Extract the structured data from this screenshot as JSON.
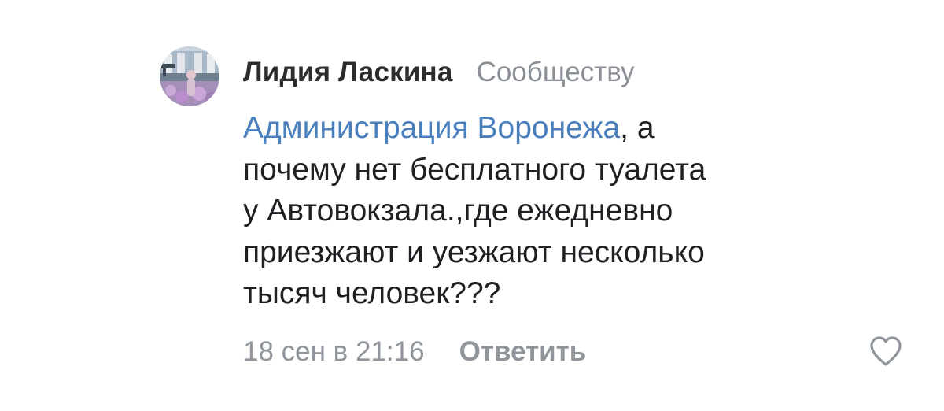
{
  "comment": {
    "author": {
      "name": "Лидия Ласкина",
      "avatar_icon": "avatar-photo"
    },
    "recipient_label": "Сообществу",
    "text": {
      "mention": "Администрация Воронежа",
      "lines": [
        ", а",
        "почему нет бесплатного туалета",
        "у Автовокзала.,где ежедневно",
        "приезжают и уезжают несколько",
        "тысяч человек???"
      ]
    },
    "timestamp": "18 сен в 21:16",
    "reply_label": "Ответить",
    "like_icon": "heart-outline-icon"
  },
  "colors": {
    "mention": "#4a7fbd",
    "muted": "#8f959b",
    "text": "#1f2023"
  }
}
